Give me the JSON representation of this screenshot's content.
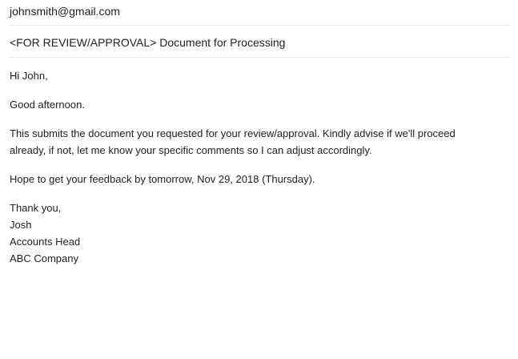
{
  "to": {
    "value": "johnsmith@gmail.com"
  },
  "subject": {
    "value": "<FOR REVIEW/APPROVAL> Document for Processing"
  },
  "body": {
    "greeting": "Hi John,",
    "salutation": "Good afternoon.",
    "paragraph_1": {
      "line_1": "This submits the document you requested for your review/approval. Kindly advise if we'll proceed",
      "line_2": "already, if not, let me know your specific comments so I can adjust accordingly."
    },
    "paragraph_2": "Hope to get your feedback by tomorrow, Nov 29, 2018 (Thursday).",
    "signature": {
      "closing": "Thank you,",
      "name": "Josh",
      "title": "Accounts Head",
      "company": "ABC Company"
    }
  }
}
